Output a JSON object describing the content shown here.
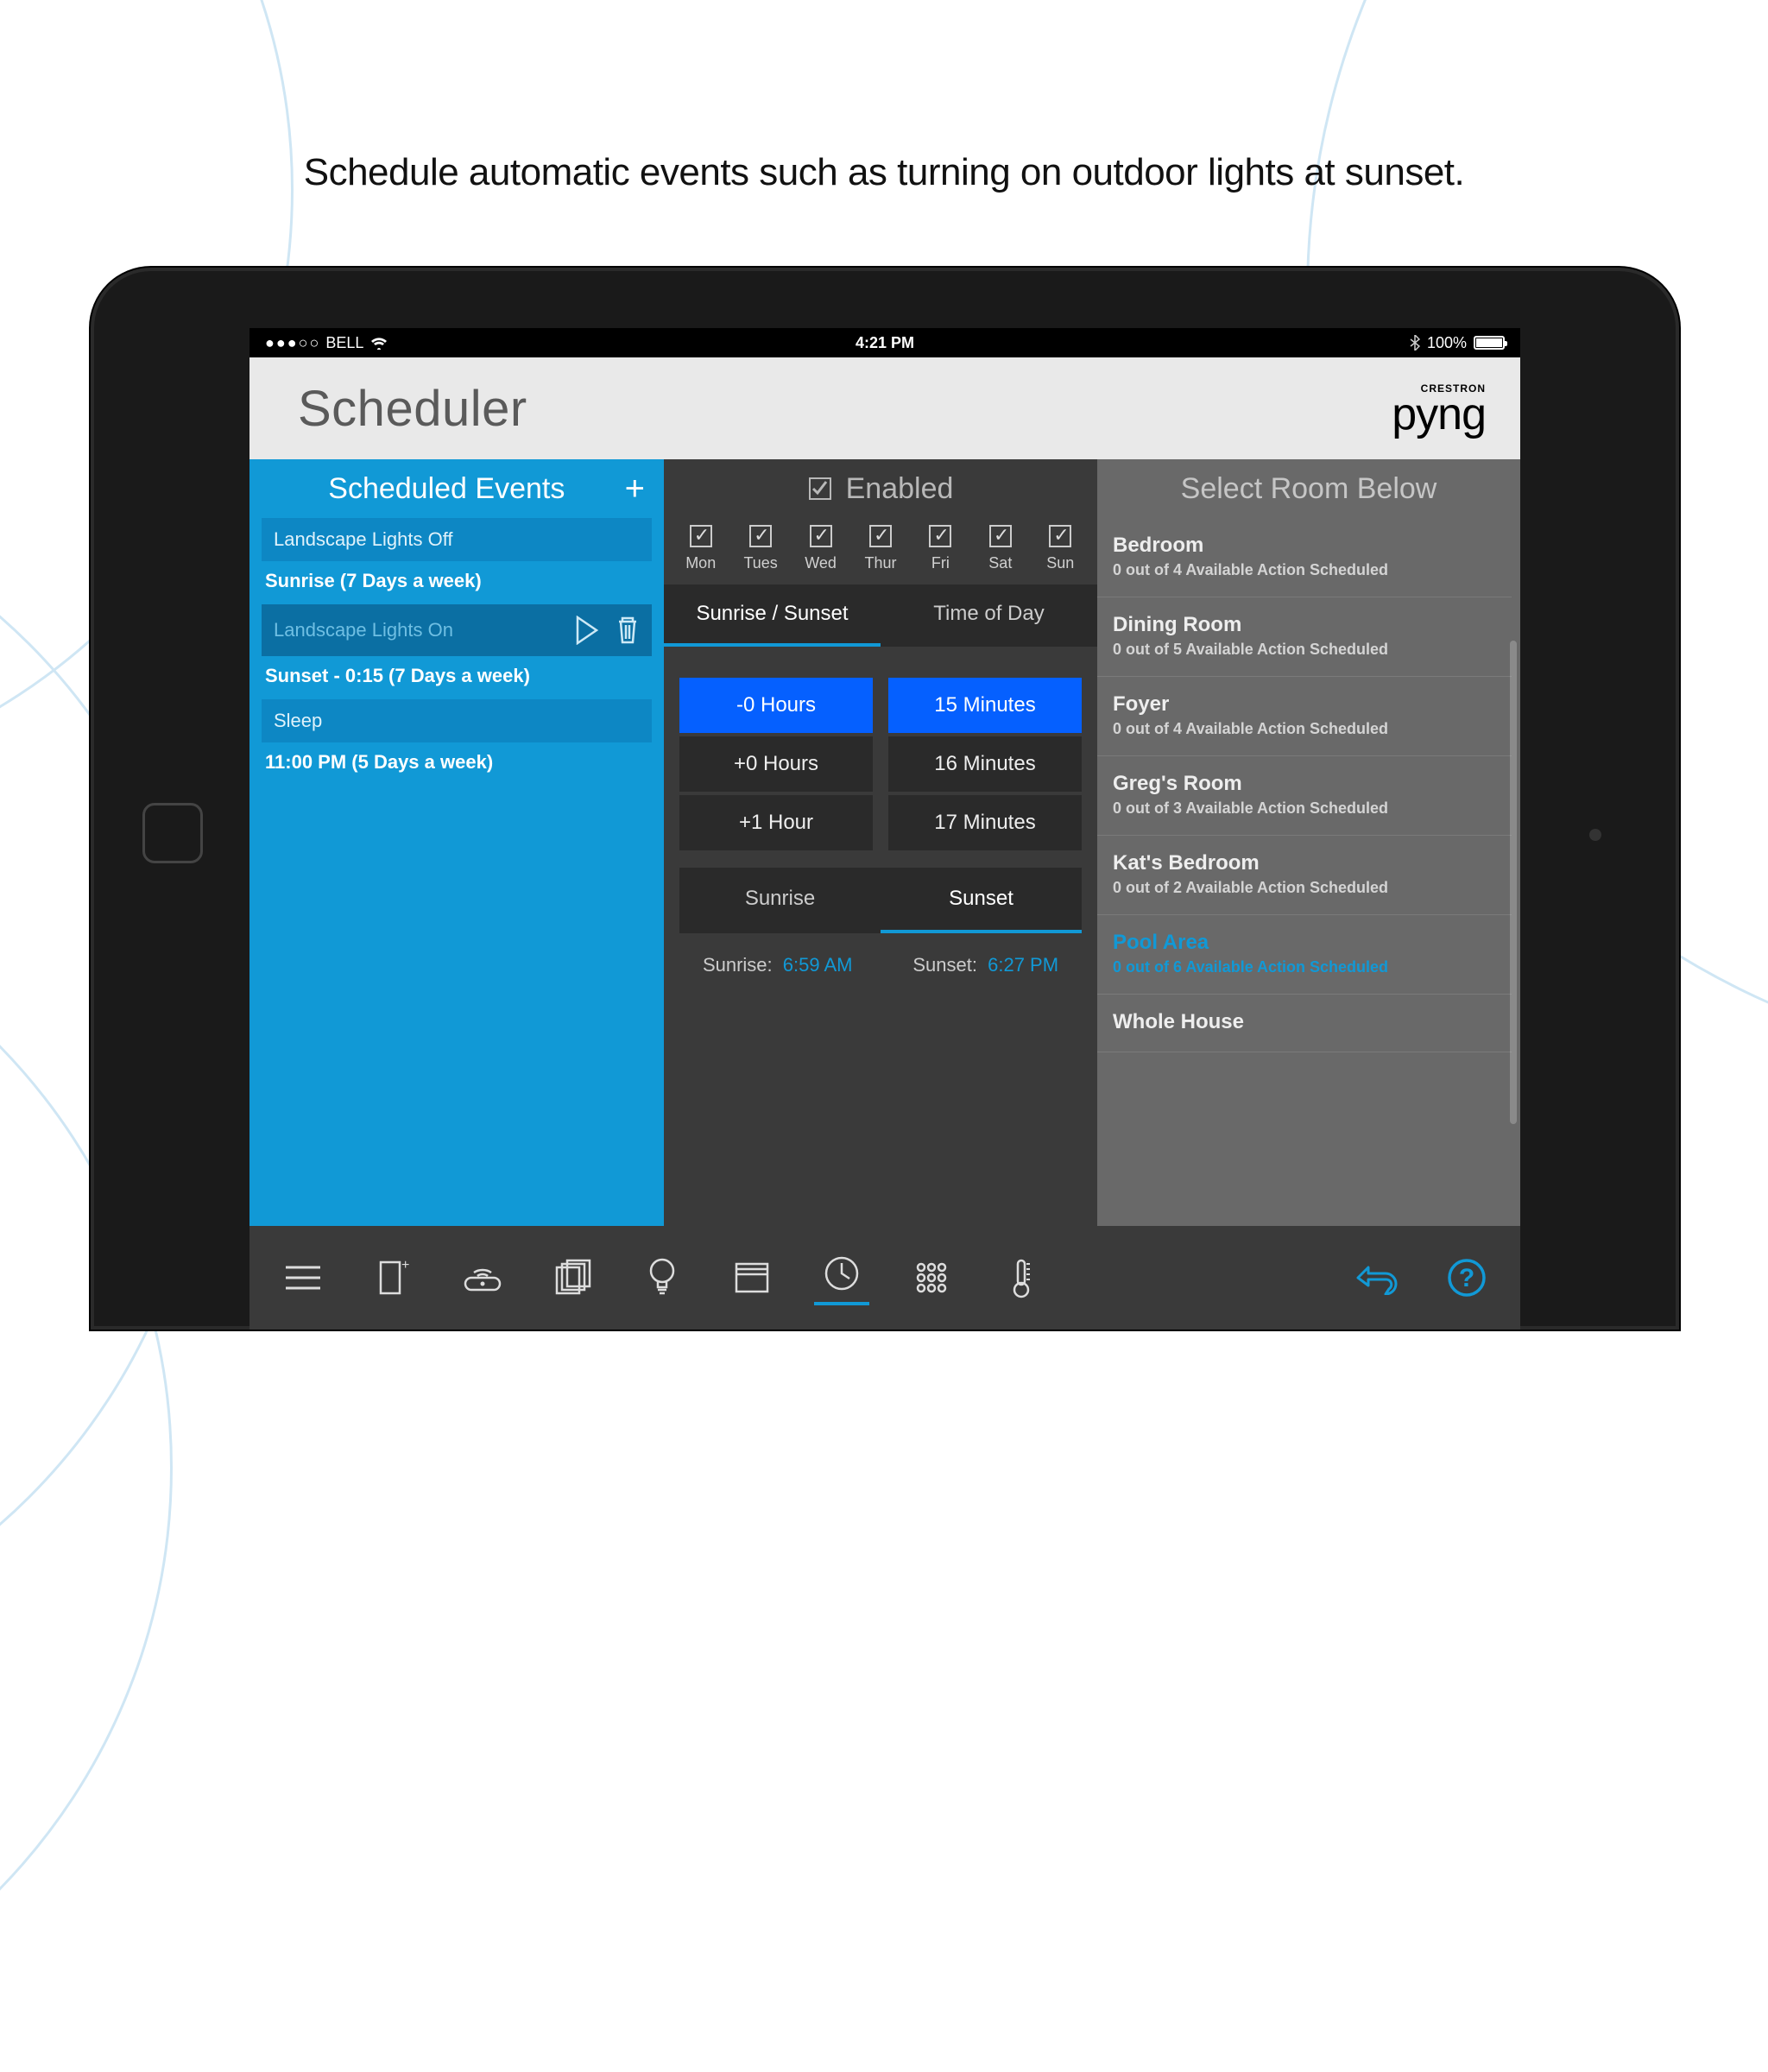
{
  "caption": "Schedule automatic events such as turning on outdoor lights at sunset.",
  "ios_status": {
    "carrier": "BELL",
    "time": "4:21 PM",
    "battery": "100%"
  },
  "app": {
    "title": "Scheduler",
    "logo_brand": "CRESTRON",
    "logo_name": "pyng"
  },
  "events_panel": {
    "header": "Scheduled Events",
    "items": [
      {
        "name": "Landscape Lights Off",
        "schedule": "Sunrise  (7 Days a week)",
        "selected": false
      },
      {
        "name": "Landscape Lights On",
        "schedule": "Sunset - 0:15 (7 Days a week)",
        "selected": true
      },
      {
        "name": "Sleep",
        "schedule": "11:00 PM (5 Days a week)",
        "selected": false
      }
    ]
  },
  "settings_panel": {
    "enabled_label": "Enabled",
    "days": [
      "Mon",
      "Tues",
      "Wed",
      "Thur",
      "Fri",
      "Sat",
      "Sun"
    ],
    "mode_tabs": {
      "a": "Sunrise / Sunset",
      "b": "Time of Day"
    },
    "hours": [
      "-0 Hours",
      "+0 Hours",
      "+1 Hour"
    ],
    "minutes": [
      "15 Minutes",
      "16 Minutes",
      "17 Minutes"
    ],
    "sun_tabs": {
      "a": "Sunrise",
      "b": "Sunset"
    },
    "sunrise_label": "Sunrise:",
    "sunrise_time": "6:59 AM",
    "sunset_label": "Sunset:",
    "sunset_time": "6:27 PM"
  },
  "rooms_panel": {
    "header": "Select Room Below",
    "items": [
      {
        "name": "Bedroom",
        "meta": "0 out of 4 Available Action Scheduled"
      },
      {
        "name": "Dining Room",
        "meta": "0 out of 5 Available Action Scheduled"
      },
      {
        "name": "Foyer",
        "meta": "0 out of 4 Available Action Scheduled"
      },
      {
        "name": "Greg's Room",
        "meta": "0 out of 3 Available Action Scheduled"
      },
      {
        "name": "Kat's Bedroom",
        "meta": "0 out of 2 Available Action Scheduled"
      },
      {
        "name": "Pool Area",
        "meta": "0 out of 6 Available Action Scheduled",
        "highlight": true
      },
      {
        "name": "Whole House",
        "meta": ""
      }
    ]
  }
}
